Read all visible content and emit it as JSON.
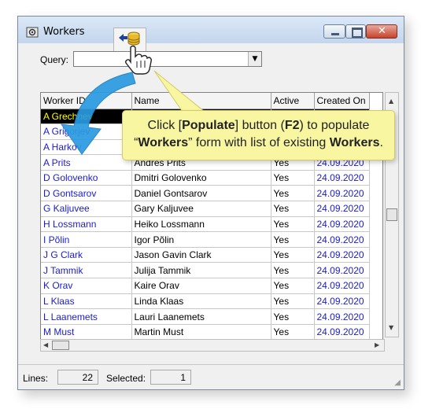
{
  "window": {
    "title": "Workers"
  },
  "query": {
    "label": "Query:",
    "value": ""
  },
  "grid": {
    "columns": [
      "Worker ID",
      "Name",
      "Active",
      "Created On"
    ],
    "rows": [
      {
        "id": "A Grechnev",
        "name": "",
        "active": "",
        "created": ""
      },
      {
        "id": "A Grigorjev",
        "name": "",
        "active": "",
        "created": ""
      },
      {
        "id": "A Harkov",
        "name": "",
        "active": "",
        "created": ""
      },
      {
        "id": "A Prits",
        "name": "Andres Prits",
        "active": "Yes",
        "created": "24.09.2020"
      },
      {
        "id": "D Golovenko",
        "name": "Dmitri Golovenko",
        "active": "Yes",
        "created": "24.09.2020"
      },
      {
        "id": "D Gontsarov",
        "name": "Daniel Gontsarov",
        "active": "Yes",
        "created": "24.09.2020"
      },
      {
        "id": "G Kaljuvee",
        "name": "Gary Kaljuvee",
        "active": "Yes",
        "created": "24.09.2020"
      },
      {
        "id": "H Lossmann",
        "name": "Heiko Lossmann",
        "active": "Yes",
        "created": "24.09.2020"
      },
      {
        "id": "I Põlin",
        "name": "Igor Põlin",
        "active": "Yes",
        "created": "24.09.2020"
      },
      {
        "id": "J G Clark",
        "name": "Jason Gavin Clark",
        "active": "Yes",
        "created": "24.09.2020"
      },
      {
        "id": "J Tammik",
        "name": "Julija Tammik",
        "active": "Yes",
        "created": "24.09.2020"
      },
      {
        "id": "K Orav",
        "name": "Kaire Orav",
        "active": "Yes",
        "created": "24.09.2020"
      },
      {
        "id": "L Klaas",
        "name": "Linda Klaas",
        "active": "Yes",
        "created": "24.09.2020"
      },
      {
        "id": "L Laanemets",
        "name": "Lauri Laanemets",
        "active": "Yes",
        "created": "24.09.2020"
      },
      {
        "id": "M Must",
        "name": "Martin Must",
        "active": "Yes",
        "created": "24.09.2020"
      }
    ]
  },
  "status": {
    "lines_label": "Lines:",
    "lines_value": "22",
    "selected_label": "Selected:",
    "selected_value": "1"
  },
  "callout": {
    "line1_pre": "Click [",
    "line1_bold1": "Populate",
    "line1_mid": "] button (",
    "line1_bold2": "F2",
    "line1_post": ") to populate",
    "line2_pre": "“",
    "line2_bold1": "Workers",
    "line2_mid": "” form with list of existing ",
    "line2_bold2": "Workers",
    "line2_post": "."
  },
  "icons": {
    "window": "workers-app-icon",
    "populate": "populate-database-icon",
    "cursor": "hand-pointer-icon"
  },
  "colors": {
    "link_blue": "#1b1bcc",
    "selected_bg": "#000000",
    "selected_fg": "#ffff00",
    "callout_bg": "#f9f6a2",
    "arrow_blue": "#2a9be0"
  }
}
